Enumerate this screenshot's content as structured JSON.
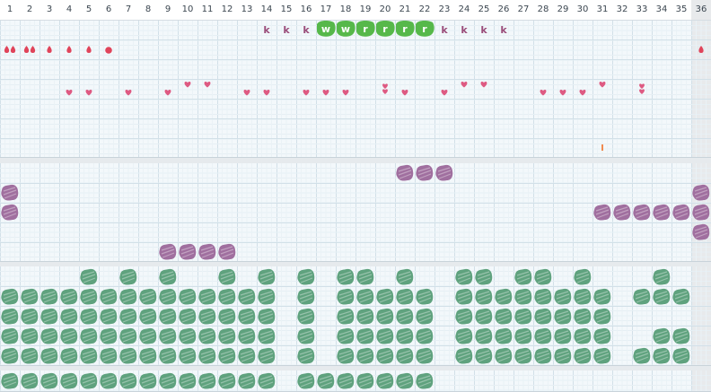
{
  "columns": [
    "1",
    "2",
    "3",
    "4",
    "5",
    "6",
    "7",
    "8",
    "9",
    "10",
    "11",
    "12",
    "13",
    "14",
    "15",
    "16",
    "17",
    "18",
    "19",
    "20",
    "21",
    "22",
    "23",
    "24",
    "25",
    "26",
    "27",
    "28",
    "29",
    "30",
    "31",
    "32",
    "33",
    "34",
    "35",
    "36"
  ],
  "colors": {
    "header_bg": "#ffffff",
    "grid_bg": "#f3f8fb",
    "grid_line": "#d2e0e8",
    "last_column_bg": "#e8eaec",
    "k_text": "#9a4d7a",
    "green_badge": "#56b84a",
    "drop_red": "#e0445a",
    "heart_pink": "#de5a82",
    "tick_orange": "#f08a50",
    "purple_blob": "#a06f9f",
    "green_blob": "#5fa27e"
  },
  "icons": {
    "drop": "water-drop-icon",
    "heart": "heart-icon",
    "tick": "tick-mark-icon",
    "purple": "purple-scribble-icon",
    "green": "green-scribble-icon",
    "badge": "green-letter-badge-icon"
  },
  "row_k_letters": [
    {
      "col": 14,
      "text": "k"
    },
    {
      "col": 15,
      "text": "k"
    },
    {
      "col": 16,
      "text": "k"
    },
    {
      "col": 23,
      "text": "k"
    },
    {
      "col": 24,
      "text": "k"
    },
    {
      "col": 25,
      "text": "k"
    },
    {
      "col": 26,
      "text": "k"
    }
  ],
  "row_k_badges": [
    {
      "col": 17,
      "text": "w"
    },
    {
      "col": 18,
      "text": "w"
    },
    {
      "col": 19,
      "text": "r"
    },
    {
      "col": 20,
      "text": "r"
    },
    {
      "col": 21,
      "text": "r"
    },
    {
      "col": 22,
      "text": "r"
    }
  ],
  "drops": [
    {
      "col": 1,
      "count": 2
    },
    {
      "col": 2,
      "count": 2
    },
    {
      "col": 3,
      "count": 1
    },
    {
      "col": 4,
      "count": 1
    },
    {
      "col": 5,
      "count": 1
    },
    {
      "col": 6,
      "count": 1,
      "round": true
    },
    {
      "col": 36,
      "count": 1
    }
  ],
  "hearts_low": [
    4,
    5,
    7,
    9,
    13,
    14,
    16,
    17,
    18,
    21,
    23,
    28,
    29,
    30
  ],
  "hearts_high": [
    10,
    11,
    24,
    25,
    31
  ],
  "hearts_double": [
    20,
    33
  ],
  "ticks": [
    31
  ],
  "purple": [
    {
      "row": 0,
      "cols": [
        21,
        22,
        23
      ]
    },
    {
      "row": 1,
      "cols": [
        1,
        36
      ]
    },
    {
      "row": 2,
      "cols": [
        1,
        31,
        32,
        33,
        34,
        35,
        36
      ]
    },
    {
      "row": 3,
      "cols": [
        36
      ]
    },
    {
      "row": 4,
      "cols": [
        9,
        10,
        11,
        12
      ]
    }
  ],
  "green": [
    {
      "row": 0,
      "cols": [
        5,
        7,
        9,
        12,
        14,
        16,
        18,
        19,
        21,
        24,
        25,
        27,
        28,
        30,
        34
      ]
    },
    {
      "row": 1,
      "cols": [
        1,
        2,
        3,
        4,
        5,
        6,
        7,
        8,
        9,
        10,
        11,
        12,
        13,
        14,
        16,
        18,
        19,
        20,
        21,
        22,
        24,
        25,
        26,
        27,
        28,
        29,
        30,
        31,
        33,
        34,
        35
      ]
    },
    {
      "row": 2,
      "cols": [
        1,
        2,
        3,
        4,
        5,
        6,
        7,
        8,
        9,
        10,
        11,
        12,
        13,
        14,
        16,
        18,
        19,
        20,
        21,
        22,
        24,
        25,
        26,
        27,
        28,
        29,
        30,
        31
      ]
    },
    {
      "row": 3,
      "cols": [
        1,
        2,
        3,
        4,
        5,
        6,
        7,
        8,
        9,
        10,
        11,
        12,
        13,
        14,
        16,
        18,
        19,
        20,
        21,
        22,
        24,
        25,
        26,
        27,
        28,
        29,
        30,
        31,
        34,
        35
      ]
    },
    {
      "row": 4,
      "cols": [
        1,
        2,
        3,
        4,
        5,
        6,
        7,
        8,
        9,
        10,
        11,
        12,
        13,
        14,
        16,
        18,
        19,
        20,
        21,
        22,
        24,
        25,
        26,
        27,
        28,
        29,
        30,
        31,
        33,
        34,
        35
      ]
    }
  ],
  "green_bottom": [
    1,
    2,
    3,
    4,
    5,
    6,
    7,
    8,
    9,
    10,
    11,
    12,
    13,
    14,
    16,
    17,
    18,
    19,
    20,
    21,
    22
  ]
}
